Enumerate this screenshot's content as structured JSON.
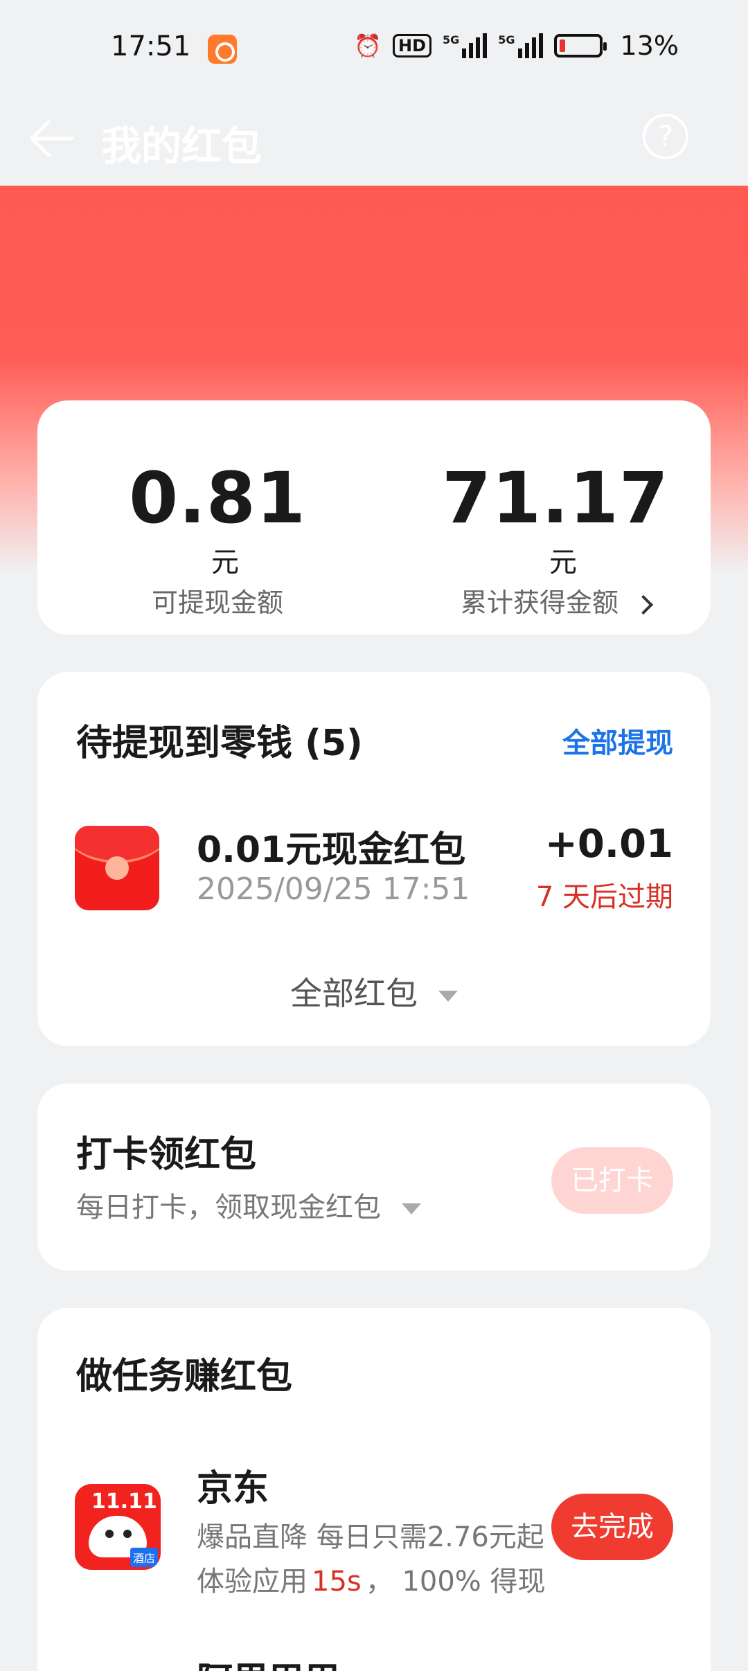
{
  "status": {
    "time": "17:51",
    "hd": "HD",
    "sig1": "5G",
    "sig2": "5G",
    "battery": "13%"
  },
  "header": {
    "title": "我的红包",
    "help": "?"
  },
  "summary": {
    "withdrawable": {
      "value": "0.81",
      "unit": "元",
      "label": "可提现金额"
    },
    "total": {
      "value": "71.17",
      "unit": "元",
      "label": "累计获得金额"
    }
  },
  "pending": {
    "title": "待提现到零钱 (5)",
    "withdraw_all": "全部提现",
    "item": {
      "title": "0.01元现金红包",
      "time": "2025/09/25 17:51",
      "amount": "+0.01",
      "expire": "7 天后过期"
    },
    "all_label": "全部红包"
  },
  "checkin": {
    "title": "打卡领红包",
    "subtitle": "每日打卡，领取现金红包",
    "button": "已打卡"
  },
  "tasks": {
    "title": "做任务赚红包",
    "items": [
      {
        "name": "京东",
        "desc": "爆品直降 每日只需2.76元起",
        "note_prefix": "体验应用",
        "note_highlight": "15s",
        "note_suffix": "， 100% 得现",
        "button": "去完成",
        "icon_top": "11.11",
        "icon_label": "酒店"
      },
      {
        "name": "阿里巴巴"
      }
    ]
  }
}
